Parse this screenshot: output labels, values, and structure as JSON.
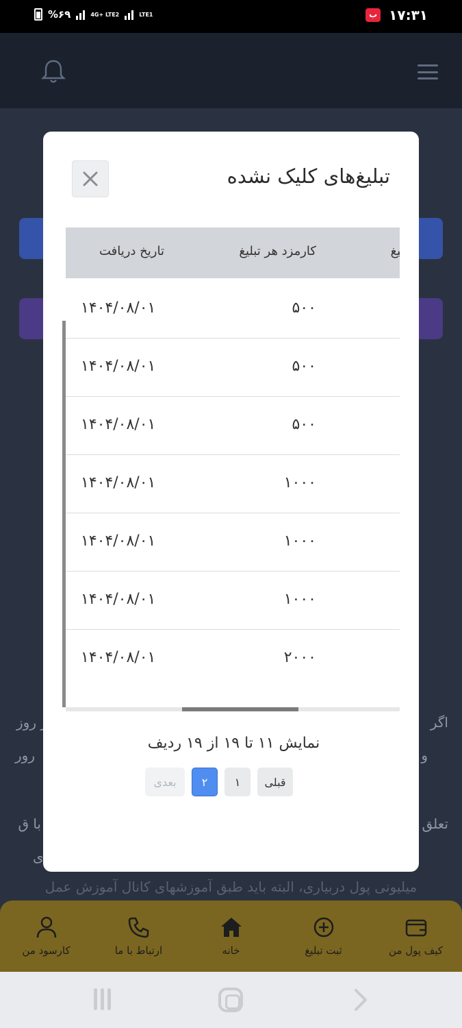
{
  "status_bar": {
    "battery": "%۶۹",
    "network1": "4G+ LTE2",
    "network2": "LTE1",
    "app_badge": "ب",
    "time": "۱۷:۳۱"
  },
  "modal": {
    "title": "تبلیغ‌های کلیک نشده",
    "close_label": "✕",
    "table": {
      "headers": {
        "date": "تاریخ دریافت",
        "fee": "کارمزد هر تبلیغ",
        "ad": "تبلیغ"
      },
      "rows": [
        {
          "date": "۱۴۰۴/۰۸/۰۱",
          "fee": "۵۰۰"
        },
        {
          "date": "۱۴۰۴/۰۸/۰۱",
          "fee": "۵۰۰"
        },
        {
          "date": "۱۴۰۴/۰۸/۰۱",
          "fee": "۵۰۰"
        },
        {
          "date": "۱۴۰۴/۰۸/۰۱",
          "fee": "۱۰۰۰"
        },
        {
          "date": "۱۴۰۴/۰۸/۰۱",
          "fee": "۱۰۰۰"
        },
        {
          "date": "۱۴۰۴/۰۸/۰۱",
          "fee": "۱۰۰۰"
        },
        {
          "date": "۱۴۰۴/۰۸/۰۱",
          "fee": "۲۰۰۰"
        }
      ]
    },
    "pagination": {
      "info": "نمایش ۱۱ تا ۱۹ از ۱۹ ردیف",
      "prev": "قبلی",
      "page1": "۱",
      "page2": "۲",
      "next": "بعدی"
    }
  },
  "background_text": {
    "line1_right": "اگر",
    "line1_left": "ر روز",
    "line2_right": "و",
    "line2_left": "رور",
    "line3_right": "با ق",
    "line3_left": "تعلق",
    "line4_right": "ی",
    "line5": "میلیونی پول دربیاری، البته باید طبق آموزشهای کانال آموزش عمل"
  },
  "bottom_nav": {
    "wallet": "کیف پول من",
    "submit_ad": "ثبت تبلیغ",
    "home": "خانه",
    "contact": "ارتباط با ما",
    "profile": "کارسود من"
  },
  "colors": {
    "modal_bg": "#ffffff",
    "header_row": "#d2d5d9",
    "active_page": "#4f8ef0",
    "bottom_nav": "#7a6620"
  }
}
